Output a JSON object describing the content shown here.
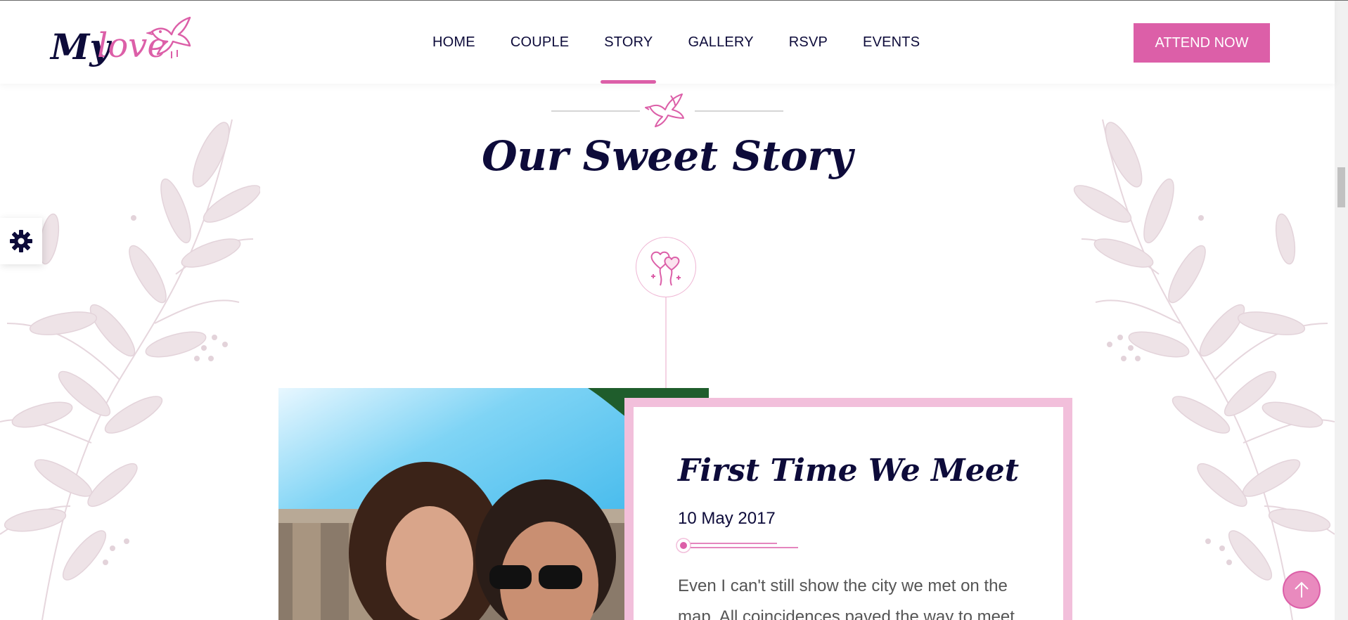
{
  "brand": {
    "logo_my": "My",
    "logo_love": "love"
  },
  "nav": {
    "items": [
      {
        "label": "HOME"
      },
      {
        "label": "COUPLE"
      },
      {
        "label": "STORY"
      },
      {
        "label": "GALLERY"
      },
      {
        "label": "RSVP"
      },
      {
        "label": "EVENTS"
      }
    ],
    "active": "STORY"
  },
  "cta": {
    "label": "ATTEND NOW"
  },
  "section": {
    "title": "Our Sweet Story"
  },
  "story": {
    "title": "First Time We Meet",
    "date": "10 May 2017",
    "text": "Even I can't still show the city we met on the map. All coincidences paved the way to meet"
  },
  "colors": {
    "accent": "#dc5fa8",
    "navy": "#0d0b3a",
    "card_border": "#f2bfdb",
    "leaf": "#e9dde2"
  },
  "icons": [
    "dove-icon",
    "gear-icon",
    "heart-balloons-icon",
    "arrow-up-icon"
  ]
}
